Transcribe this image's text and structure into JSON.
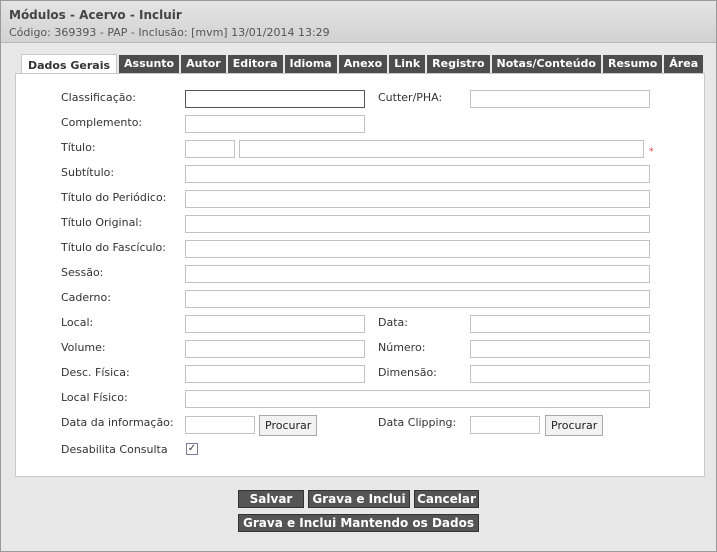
{
  "header": {
    "title": "Módulos - Acervo - Incluir",
    "subtitle": "Código: 369393 - PAP - Inclusão: [mvm] 13/01/2014 13:29"
  },
  "tabs": [
    {
      "label": "Dados Gerais"
    },
    {
      "label": "Assunto"
    },
    {
      "label": "Autor"
    },
    {
      "label": "Editora"
    },
    {
      "label": "Idioma"
    },
    {
      "label": "Anexo"
    },
    {
      "label": "Link"
    },
    {
      "label": "Registro"
    },
    {
      "label": "Notas/Conteúdo"
    },
    {
      "label": "Resumo"
    },
    {
      "label": "Área"
    }
  ],
  "form": {
    "classificacao": "Classificação:",
    "cutter": "Cutter/PHA:",
    "complemento": "Complemento:",
    "titulo": "Título:",
    "titulo_required": "*",
    "subtitulo": "Subtítulo:",
    "titulo_periodico": "Título do Periódico:",
    "titulo_original": "Título Original:",
    "titulo_fasciculo": "Título do Fascículo:",
    "sessao": "Sessão:",
    "caderno": "Caderno:",
    "local": "Local:",
    "data": "Data:",
    "volume": "Volume:",
    "numero": "Número:",
    "desc_fisica": "Desc. Física:",
    "dimensao": "Dimensão:",
    "local_fisico": "Local Físico:",
    "data_informacao": "Data da informação:",
    "data_clipping": "Data Clipping:",
    "procurar": "Procurar",
    "desabilita_consulta": "Desabilita Consulta",
    "check_mark": "✓"
  },
  "actions": {
    "salvar": "Salvar",
    "grava_inclui": "Grava e Inclui",
    "cancelar": "Cancelar",
    "grava_inclui_mantendo": "Grava e Inclui Mantendo os Dados"
  }
}
